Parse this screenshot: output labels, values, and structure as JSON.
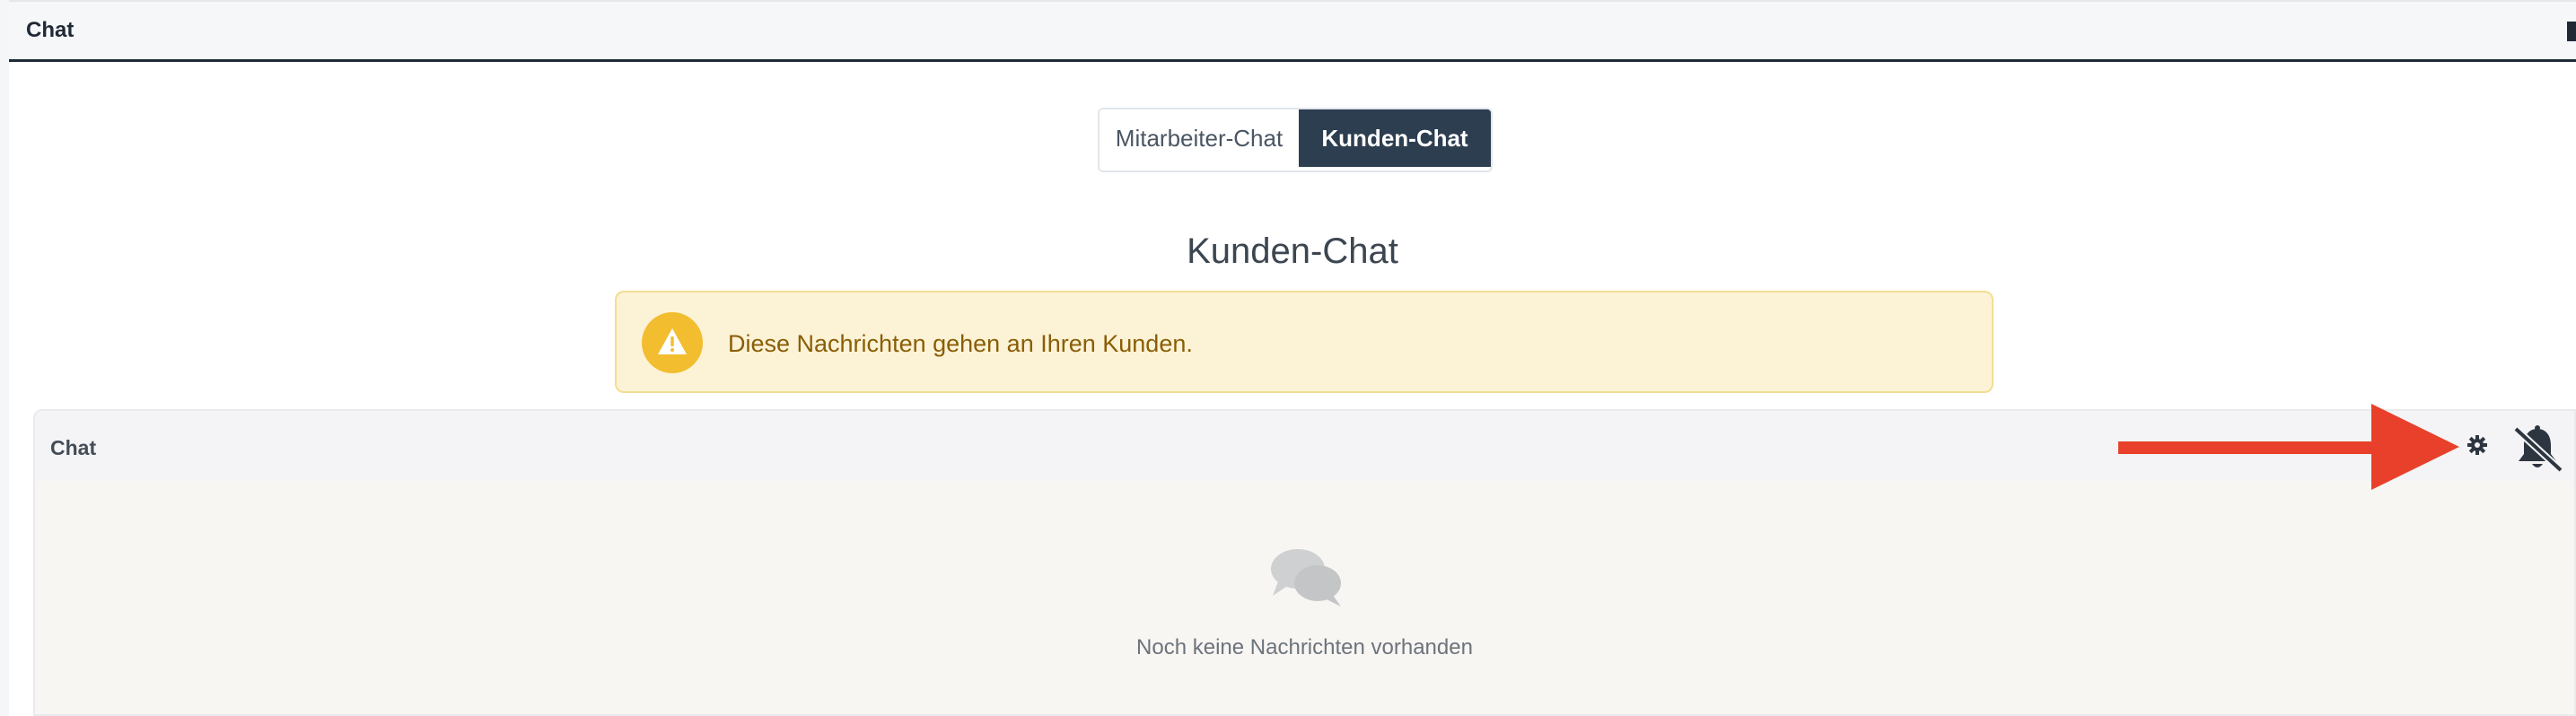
{
  "header": {
    "title": "Chat"
  },
  "tabs": [
    {
      "label": "Mitarbeiter-Chat",
      "active": false
    },
    {
      "label": "Kunden-Chat",
      "active": true
    }
  ],
  "section": {
    "title": "Kunden-Chat"
  },
  "alert": {
    "text": "Diese Nachrichten gehen an Ihren Kunden.",
    "icon": "warning-icon"
  },
  "chat": {
    "title": "Chat",
    "empty_text": "Noch keine Nachrichten vorhanden",
    "actions": [
      {
        "icon": "gear-icon"
      },
      {
        "icon": "bell-slash-icon"
      }
    ]
  },
  "colors": {
    "accent_dark": "#2c3e4f",
    "warning": "#f2bd2f",
    "annotation_arrow": "#e8402a"
  }
}
